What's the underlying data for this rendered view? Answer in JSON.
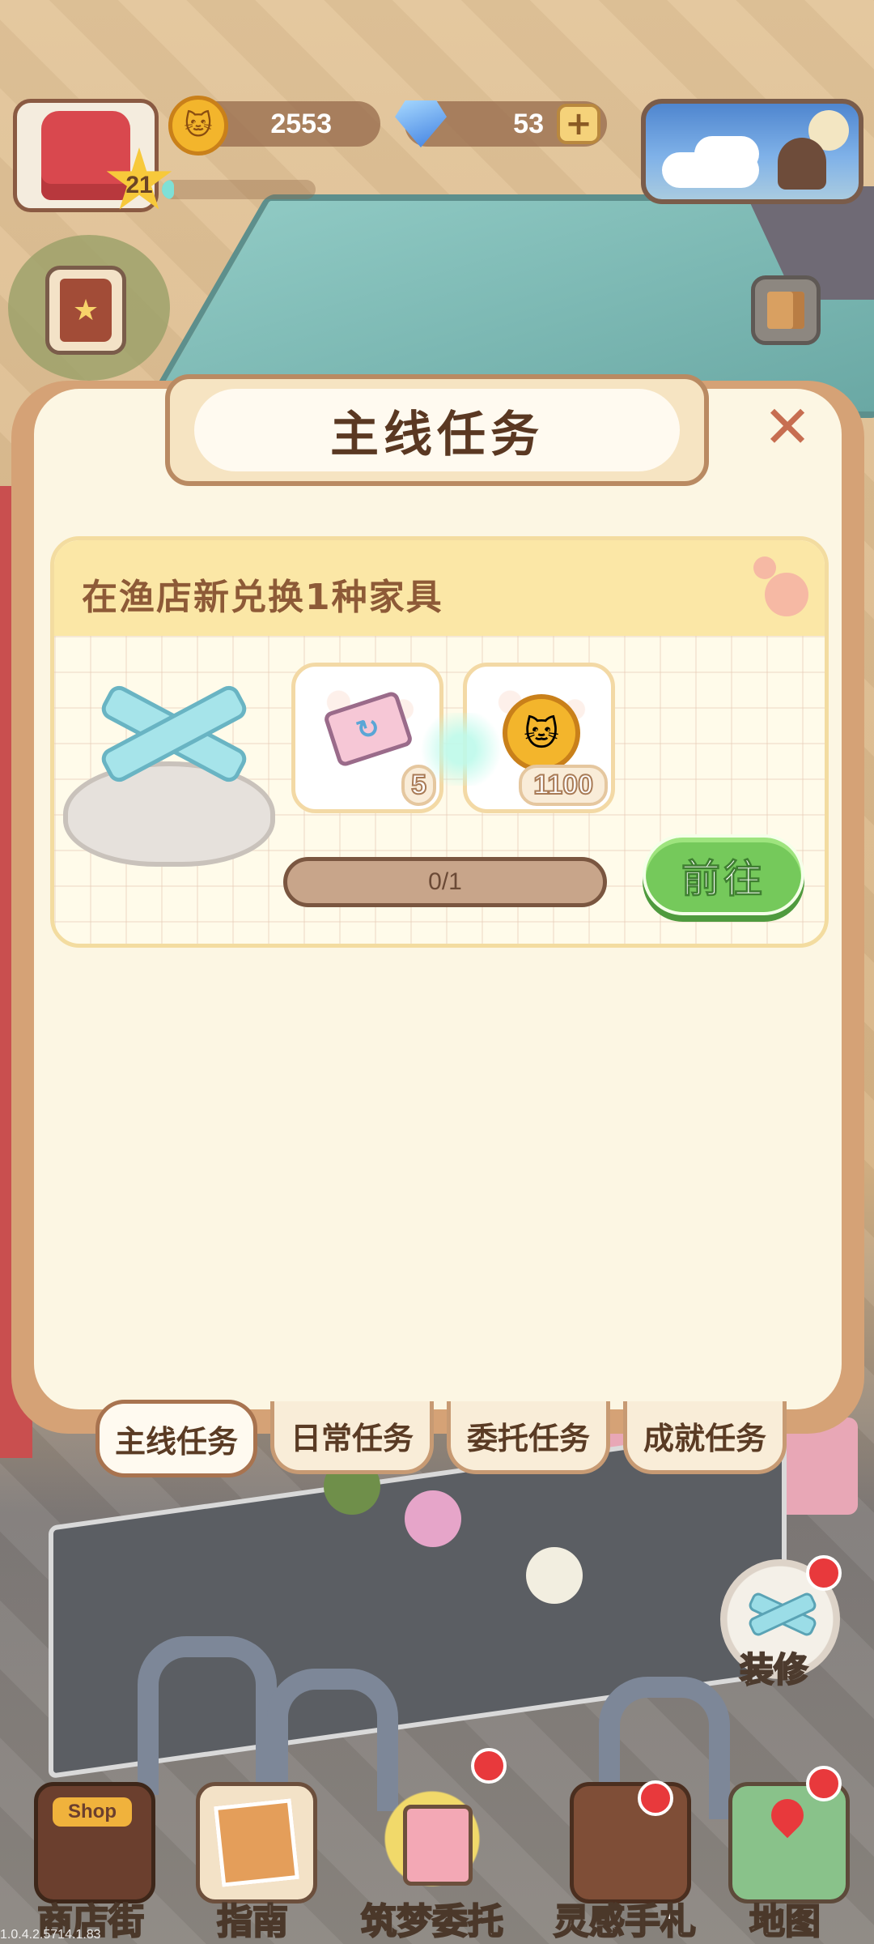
{
  "hud": {
    "level": "21",
    "xp_progress_fraction": 0.08,
    "coins": "2553",
    "gems": "53",
    "plus_symbol": "+"
  },
  "panel": {
    "title": "主线任务",
    "close_symbol": "✕"
  },
  "quest": {
    "title": "在渔店新兑换1种家具",
    "rewards": [
      {
        "icon": "ticket-icon",
        "count": "5"
      },
      {
        "icon": "coin-icon",
        "count": "1100"
      }
    ],
    "progress_text": "0/1",
    "progress_fraction": 0,
    "go_button": "前往"
  },
  "tabs": [
    {
      "label": "主线任务",
      "active": true
    },
    {
      "label": "日常任务",
      "active": false
    },
    {
      "label": "委托任务",
      "active": false
    },
    {
      "label": "成就任务",
      "active": false
    }
  ],
  "side": {
    "decorate_label": "装修"
  },
  "nav": [
    {
      "label": "商店街",
      "icon": "shop-icon",
      "sign": "Shop",
      "badge": false
    },
    {
      "label": "指南",
      "icon": "guide-icon",
      "badge": false
    },
    {
      "label": "筑梦委托",
      "icon": "dream-notebook-icon",
      "badge": true
    },
    {
      "label": "灵感手札",
      "icon": "idea-book-icon",
      "badge": true
    },
    {
      "label": "地图",
      "icon": "map-icon",
      "badge": true
    }
  ],
  "version": "1.0.4.2.5714.1.83",
  "colors": {
    "panel_bg": "#fcf6e3",
    "panel_border": "#d5a276",
    "go_button": "#75c95b",
    "badge_red": "#e8393c",
    "title_text": "#5a3822"
  }
}
